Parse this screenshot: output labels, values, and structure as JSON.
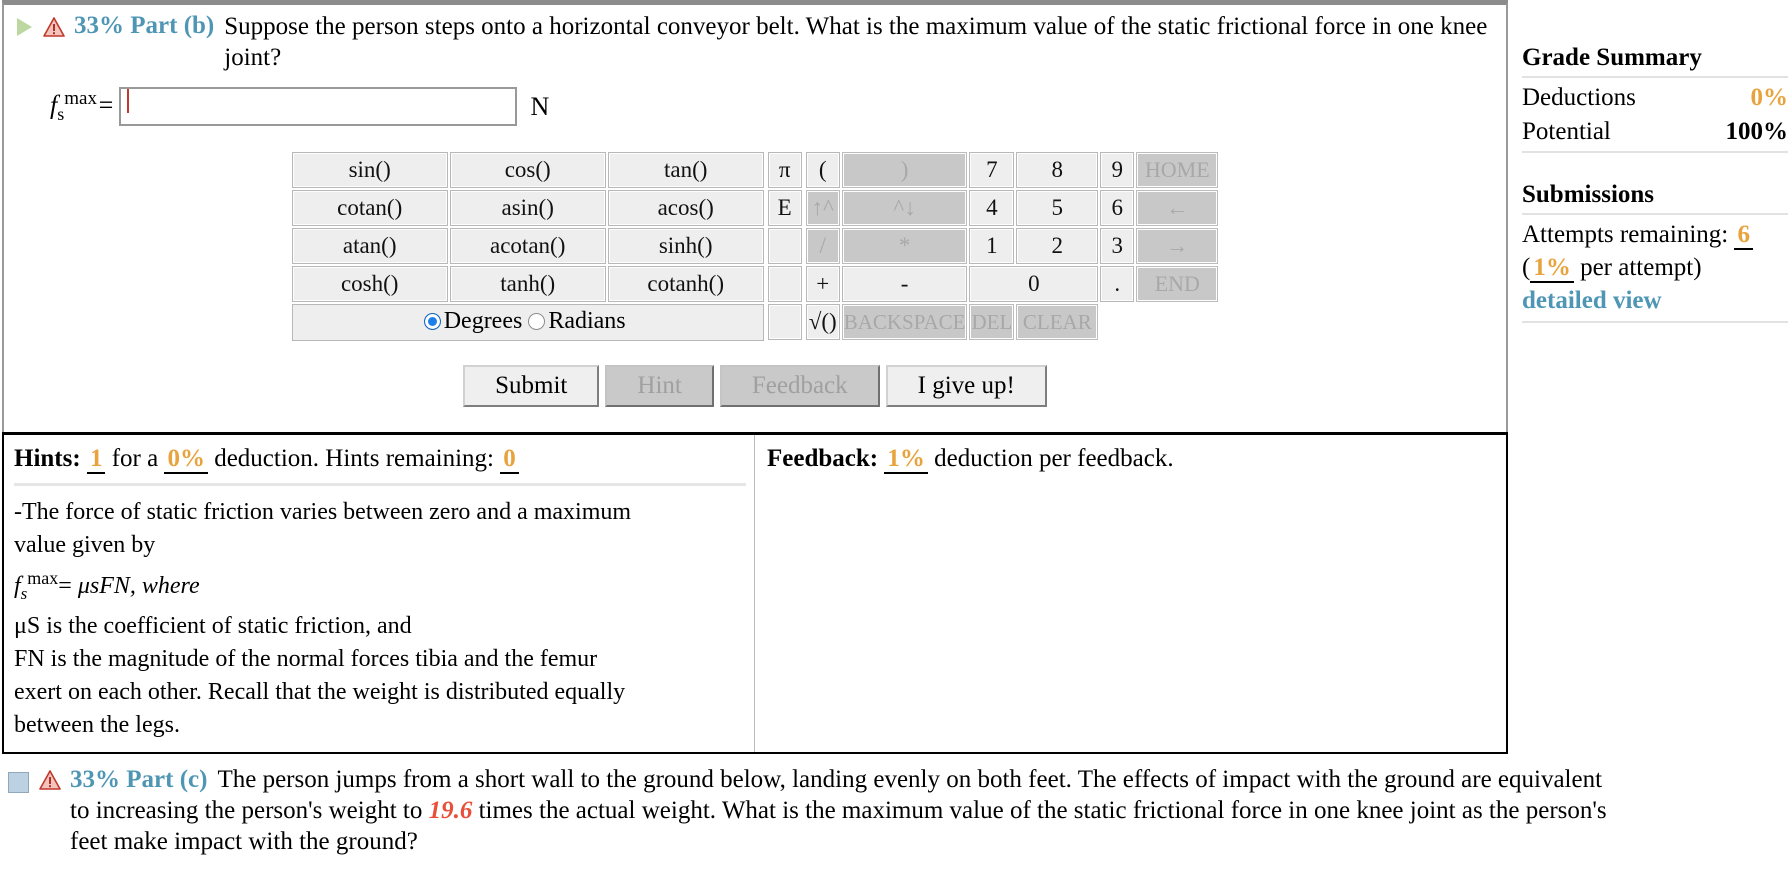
{
  "part_b": {
    "percent_label": "33% Part (b)",
    "prompt": "Suppose the person steps onto a horizontal conveyor belt. What is the maximum value of the static frictional force in one knee joint?",
    "answer": {
      "var_f": "f",
      "var_sup": "max",
      "var_sub": "s",
      "equals": "=",
      "value": "",
      "unit": "N"
    },
    "icons": {
      "expand": "play-triangle-icon",
      "alert": "warning-triangle-icon"
    }
  },
  "calculator": {
    "functions": [
      [
        "sin()",
        "cos()",
        "tan()"
      ],
      [
        "cotan()",
        "asin()",
        "acos()"
      ],
      [
        "atan()",
        "acotan()",
        "sinh()"
      ],
      [
        "cosh()",
        "tanh()",
        "cotanh()"
      ]
    ],
    "angle_mode": {
      "degrees": "Degrees",
      "radians": "Radians",
      "selected": "Degrees"
    },
    "const_col": [
      "π",
      "E",
      "",
      "",
      ""
    ],
    "op_grid": [
      [
        {
          "l": "(",
          "d": false
        },
        {
          "l": ")",
          "d": true
        },
        {
          "l": "7",
          "d": false
        },
        {
          "l": "8",
          "d": false
        },
        {
          "l": "9",
          "d": false
        },
        {
          "l": "HOME",
          "d": true
        }
      ],
      [
        {
          "l": "↑^",
          "d": true
        },
        {
          "l": "^↓",
          "d": true
        },
        {
          "l": "4",
          "d": false
        },
        {
          "l": "5",
          "d": false
        },
        {
          "l": "6",
          "d": false
        },
        {
          "l": "←",
          "d": true
        }
      ],
      [
        {
          "l": "/",
          "d": true
        },
        {
          "l": "*",
          "d": true
        },
        {
          "l": "1",
          "d": false
        },
        {
          "l": "2",
          "d": false
        },
        {
          "l": "3",
          "d": false
        },
        {
          "l": "→",
          "d": true
        }
      ],
      [
        {
          "l": "+",
          "d": false
        },
        {
          "l": "-",
          "d": false
        },
        {
          "l": "0",
          "d": false
        },
        {
          "l": ".",
          "d": false
        },
        {
          "l": "END",
          "d": true
        }
      ],
      [
        {
          "l": "√()",
          "d": false
        },
        {
          "l": "BACKSPACE",
          "d": true
        },
        {
          "l": "DEL",
          "d": true
        },
        {
          "l": "CLEAR",
          "d": true
        }
      ]
    ]
  },
  "actions": {
    "submit": "Submit",
    "hint": "Hint",
    "feedback": "Feedback",
    "give_up": "I give up!",
    "submit_enabled": true,
    "hint_enabled": false,
    "feedback_enabled": false,
    "give_up_enabled": true
  },
  "hints": {
    "title": "Hints:",
    "count": "1",
    "for_a": "for a",
    "deduction_pct": "0%",
    "deduction_text": "deduction. Hints remaining:",
    "remaining": "0",
    "body_lines": [
      "-The force of static friction varies between zero and a maximum",
      "value given by",
      "FORMULA",
      "μS is the coefficient of static friction, and",
      "FN is the magnitude of the normal forces tibia and the femur",
      "exert on each other. Recall that the weight is distributed equally",
      "between the legs."
    ],
    "formula": {
      "f": "f",
      "sup": "max",
      "sub": "s",
      "equals": "=",
      "rhs": "μsFN, where"
    }
  },
  "feedback": {
    "title": "Feedback:",
    "deduction_pct": "1%",
    "deduction_text": "deduction per feedback."
  },
  "grade_summary": {
    "title": "Grade Summary",
    "rows": [
      {
        "label": "Deductions",
        "value": "0%",
        "highlight": true
      },
      {
        "label": "Potential",
        "value": "100%",
        "highlight": false
      }
    ]
  },
  "submissions": {
    "title": "Submissions",
    "attempts_label": "Attempts remaining:",
    "attempts_value": "6",
    "per_attempt_open": "(",
    "per_attempt_pct": "1%",
    "per_attempt_text": " per attempt)",
    "detailed_view": "detailed view"
  },
  "part_c": {
    "percent_label": "33% Part (c)",
    "text_before": "The person jumps from a short wall to the ground below, landing evenly on both feet. The effects of impact with the ground are equivalent to increasing the person's weight to ",
    "value": "19.6",
    "text_after": " times the actual weight. What is the maximum value of the static frictional force in one knee joint as the person's feet make impact with the ground?",
    "icons": {
      "collapse": "square-checkbox-icon",
      "alert": "warning-triangle-icon"
    }
  },
  "colors": {
    "accent_blue": "#4f96b5",
    "orange": "#e8a33d",
    "red": "#e8503a",
    "key_bg": "#eeeeee",
    "key_disabled": "#c8c8c8"
  }
}
